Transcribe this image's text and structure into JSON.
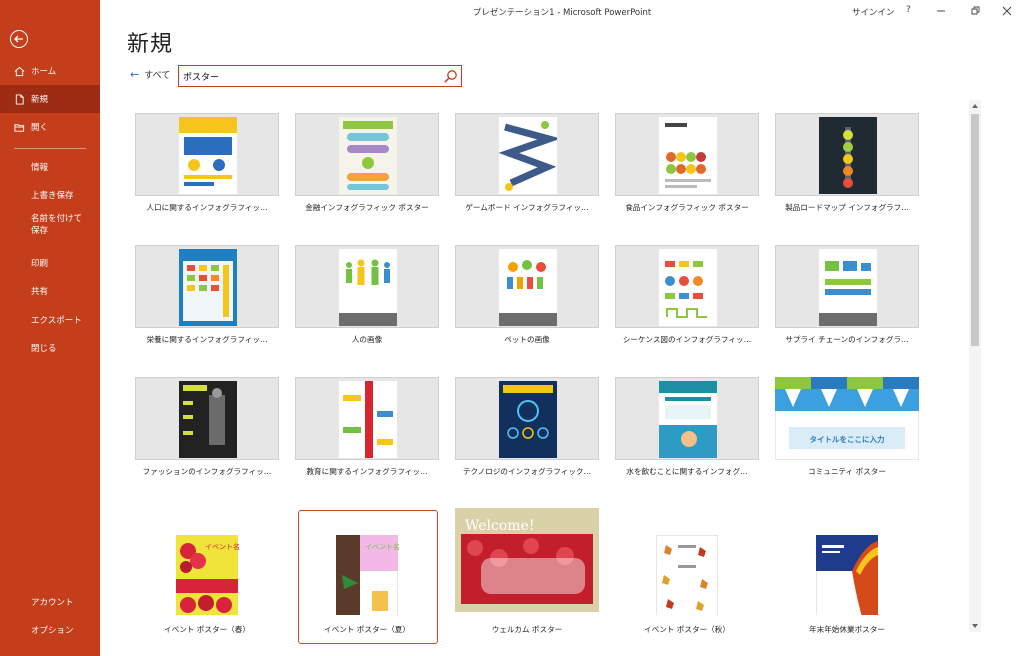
{
  "window": {
    "title": "プレゼンテーション1  -  Microsoft PowerPoint",
    "signin": "サインイン",
    "help": "?"
  },
  "sidebar": {
    "items": [
      {
        "label": "ホーム"
      },
      {
        "label": "新規"
      },
      {
        "label": "開く"
      },
      {
        "label": "情報"
      },
      {
        "label": "上書き保存"
      },
      {
        "label": "名前を付けて保存"
      },
      {
        "label": "印刷"
      },
      {
        "label": "共有"
      },
      {
        "label": "エクスポート"
      },
      {
        "label": "閉じる"
      },
      {
        "label": "アカウント"
      },
      {
        "label": "オプション"
      }
    ]
  },
  "page": {
    "title": "新規",
    "back_label": "すべて"
  },
  "search": {
    "value": "ポスター"
  },
  "templates": [
    {
      "label": "人口に関するインフォグラフィッ…",
      "accent": "#f5c51b"
    },
    {
      "label": "金融インフォグラフィック ポスター",
      "accent": "#8ec63f"
    },
    {
      "label": "ゲームボード インフォグラフィッ…",
      "accent": "#3d5a8a"
    },
    {
      "label": "食品インフォグラフィック ポスター",
      "accent": "#e06a2b"
    },
    {
      "label": "製品ロードマップ インフォグラフ…",
      "accent": "#1f2a33"
    },
    {
      "label": "栄養に関するインフォグラフィッ…",
      "accent": "#1e7fc1"
    },
    {
      "label": "人の画像",
      "accent": "#74c043"
    },
    {
      "label": "ペットの画像",
      "accent": "#f4a100"
    },
    {
      "label": "シーケンス図のインフォグラフィッ…",
      "accent": "#e94e3c"
    },
    {
      "label": "サプライ チェーンのインフォグラ…",
      "accent": "#3b8fd0"
    },
    {
      "label": "ファッションのインフォグラフィッ…",
      "accent": "#222222"
    },
    {
      "label": "教育に関するインフォグラフィッ…",
      "accent": "#d8262e"
    },
    {
      "label": "テクノロジのインフォグラフィック…",
      "accent": "#12305c"
    },
    {
      "label": "水を飲むことに関するインフォグ…",
      "accent": "#1d8fa5"
    },
    {
      "label": "コミュニティ ポスター",
      "accent": "#3c9fe0",
      "poster_text": "タイトルをここに入力"
    },
    {
      "label": "イベント ポスター（春）",
      "accent": "#d7243a",
      "poster_text": "イベント名"
    },
    {
      "label": "イベント ポスター（夏）",
      "accent": "#5a3b2a",
      "poster_text": "イベント名"
    },
    {
      "label": "ウェルカム ポスター",
      "accent": "#c21e2b",
      "poster_text": "Welcome!"
    },
    {
      "label": "イベント ポスター（秋）",
      "accent": "#d9832a"
    },
    {
      "label": "年末年始休業ポスター",
      "accent": "#d64a1a"
    }
  ],
  "colors": {
    "sidebar": "#c43e1c",
    "sidebar_active": "#9e2c13",
    "accent_border": "#d24726"
  }
}
